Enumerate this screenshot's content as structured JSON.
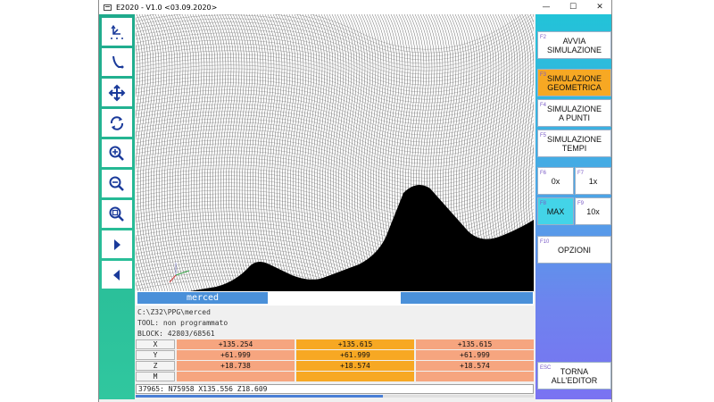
{
  "window": {
    "title": "E2020 - V1.0 <03.09.2020>",
    "minimize_glyph": "—",
    "maximize_glyph": "☐",
    "close_glyph": "✕"
  },
  "toolbar": {
    "items": [
      {
        "name": "view-axes-tool",
        "icon": "axes-icon"
      },
      {
        "name": "tool-path-tool",
        "icon": "tool-path-icon"
      },
      {
        "name": "pan-tool",
        "icon": "move-arrows-icon"
      },
      {
        "name": "rotate-tool",
        "icon": "rotate-icon"
      },
      {
        "name": "zoom-in-tool",
        "icon": "zoom-in-icon"
      },
      {
        "name": "zoom-out-tool",
        "icon": "zoom-out-icon"
      },
      {
        "name": "zoom-fit-tool",
        "icon": "zoom-fit-icon"
      },
      {
        "name": "next-tool",
        "icon": "play-right-icon"
      },
      {
        "name": "previous-tool",
        "icon": "play-left-icon"
      }
    ]
  },
  "viewport": {
    "program_label": "merced"
  },
  "info": {
    "path": "C:\\Z32\\PPG\\merced",
    "tool": "TOOL: non programmato",
    "block": "BLOCK: 42803/68561"
  },
  "coords": {
    "rows": [
      {
        "axis": "X",
        "v1": "+135.254",
        "v2": "+135.615",
        "v3": "+135.615"
      },
      {
        "axis": "Y",
        "v1": "+61.999",
        "v2": "+61.999",
        "v3": "+61.999"
      },
      {
        "axis": "Z",
        "v1": "+18.738",
        "v2": "+18.574",
        "v3": "+18.574"
      },
      {
        "axis": "M",
        "v1": "",
        "v2": "",
        "v3": ""
      }
    ]
  },
  "status": {
    "line": "37965: N75958 X135.556 Z18.609",
    "progress": 0.62
  },
  "right_panel": {
    "avvia": {
      "fkey": "F2",
      "label": "AVVIA\nSIMULAZIONE"
    },
    "geometrica": {
      "fkey": "F3",
      "label": "SIMULAZIONE\nGEOMETRICA"
    },
    "punti": {
      "fkey": "F4",
      "label": "SIMULAZIONE\nA PUNTI"
    },
    "tempi": {
      "fkey": "F5",
      "label": "SIMULAZIONE\nTEMPI"
    },
    "speed_0x": {
      "fkey": "F6",
      "label": "0x"
    },
    "speed_1x": {
      "fkey": "F7",
      "label": "1x"
    },
    "speed_max": {
      "fkey": "F8",
      "label": "MAX"
    },
    "speed_10x": {
      "fkey": "F9",
      "label": "10x"
    },
    "opzioni": {
      "fkey": "F10",
      "label": "OPZIONI"
    },
    "torna": {
      "fkey": "ESC",
      "label": "TORNA\nALL'EDITOR"
    }
  },
  "colors": {
    "toolbar_green": "#25b894",
    "active_orange": "#f7a823",
    "selected_cyan": "#43d4e8",
    "coord_salmon": "#f6a57f",
    "label_blue": "#4a90d9"
  }
}
